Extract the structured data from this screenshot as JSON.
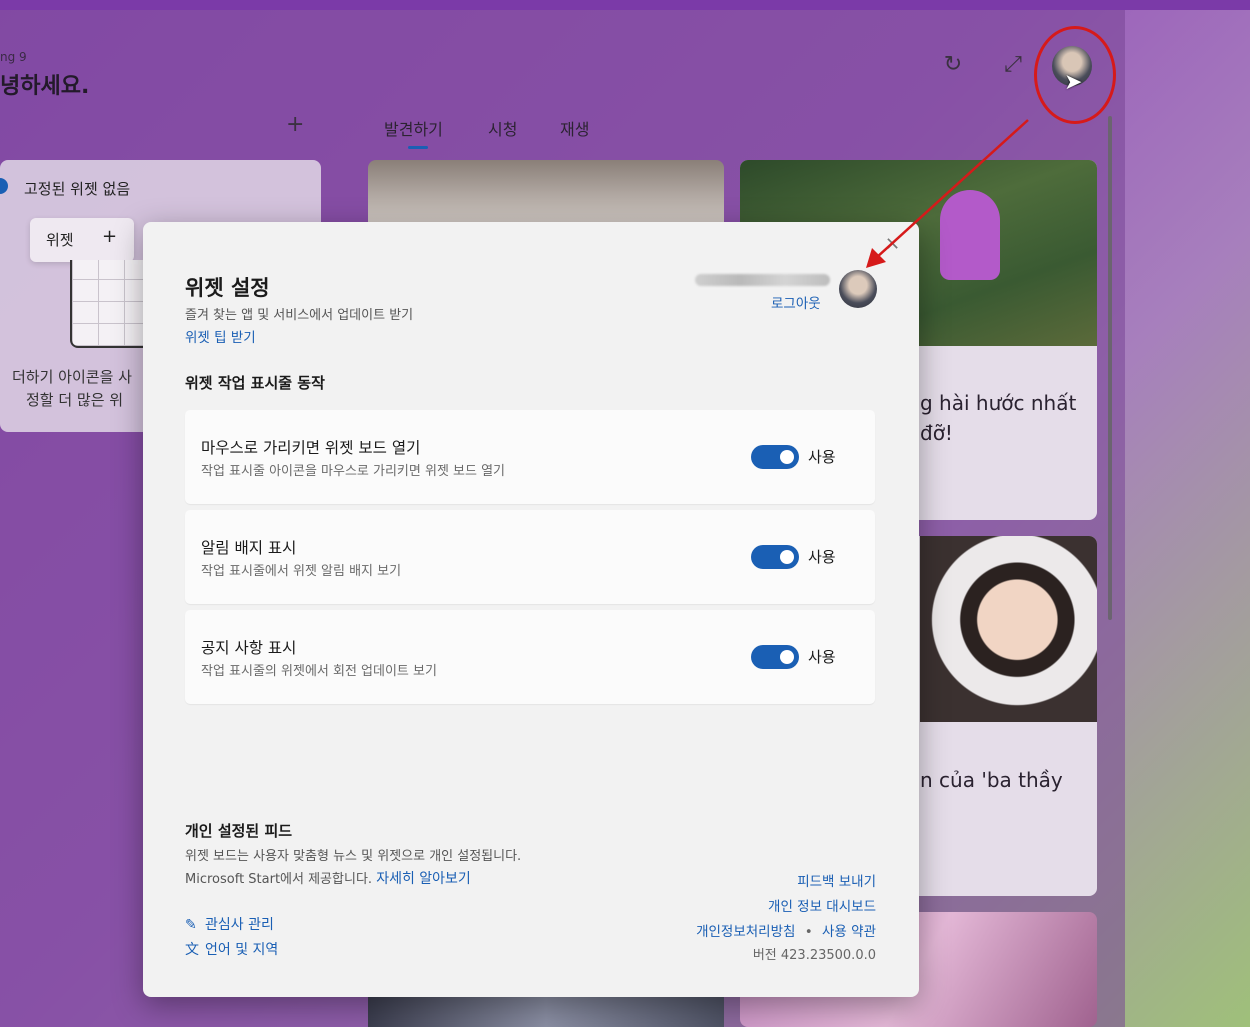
{
  "background_board": {
    "subtitle_partial": "ng 9",
    "greeting_partial": "녕하세요.",
    "tabs": [
      {
        "label": "발견하기",
        "active": true
      },
      {
        "label": "시청",
        "active": false
      },
      {
        "label": "재생",
        "active": false
      }
    ],
    "pinned_card": {
      "title": "고정된 위젯 없음",
      "chip_label": "위젯",
      "hint_line1": "더하기 아이콘을 사",
      "hint_line2": "정할 더 많은 위"
    },
    "news": [
      {
        "title_line1": "g hài hước nhất",
        "title_line2": "đỡ!"
      },
      {
        "title_line1": "n của 'ba thầy"
      }
    ]
  },
  "icons": {
    "refresh": "refresh-icon",
    "expand": "expand-icon",
    "add": "plus-icon",
    "edit": "pencil-icon",
    "language": "language-icon",
    "close": "close-icon"
  },
  "settings_dialog": {
    "title": "위젯 설정",
    "subtitle": "즐겨 찾는 앱 및 서비스에서 업데이트 받기",
    "tips_link": "위젯 팁 받기",
    "signout_link": "로그아웃",
    "section_title": "위젯 작업 표시줄 동작",
    "options": [
      {
        "title": "마우스로 가리키면 위젯 보드 열기",
        "desc": "작업 표시줄 아이콘을 마우스로 가리키면 위젯 보드 열기",
        "state_label": "사용",
        "on": true
      },
      {
        "title": "알림 배지 표시",
        "desc": "작업 표시줄에서 위젯 알림 배지 보기",
        "state_label": "사용",
        "on": true
      },
      {
        "title": "공지 사항 표시",
        "desc": "작업 표시줄의 위젯에서 회전 업데이트 보기",
        "state_label": "사용",
        "on": true
      }
    ],
    "feed": {
      "title": "개인 설정된 피드",
      "line1": "위젯 보드는 사용자 맞춤형 뉴스 및 위젯으로 개인 설정됩니다.",
      "line2": "Microsoft Start에서 제공합니다.",
      "learn_more": "자세히 알아보기"
    },
    "bottom_links": {
      "manage_interests": "관심사 관리",
      "language_region": "언어 및 지역"
    },
    "right_links": {
      "feedback": "피드백 보내기",
      "privacy_dashboard": "개인 정보 대시보드",
      "privacy_policy": "개인정보처리방침",
      "separator": "•",
      "terms": "사용 약관"
    },
    "version": "버전 423.23500.0.0"
  },
  "colors": {
    "accent": "#1a5fb4",
    "annotation": "#d61a1a"
  }
}
